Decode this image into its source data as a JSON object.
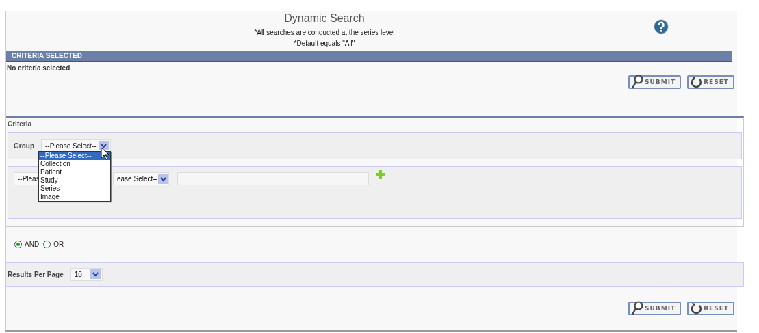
{
  "header": {
    "title": "Dynamic Search",
    "notes": [
      "*All searches are conducted at the series level",
      "*Default equals \"All\""
    ]
  },
  "criteria_selected": {
    "heading": "CRITERIA SELECTED",
    "message": "No criteria selected"
  },
  "actions_top": [
    {
      "kind": "submit",
      "label": "SUBMIT"
    },
    {
      "kind": "reset",
      "label": "RESET"
    }
  ],
  "criteria": {
    "heading": "Criteria",
    "group": {
      "label": "Group",
      "value": "--Please Select--",
      "expanded": true,
      "options": [
        {
          "label": "--Please Select--",
          "selected": true
        },
        {
          "label": "Collection",
          "selected": false
        },
        {
          "label": "Patient",
          "selected": false
        },
        {
          "label": "Study",
          "selected": false
        },
        {
          "label": "Series",
          "selected": false
        },
        {
          "label": "Image",
          "selected": false
        }
      ]
    },
    "row": {
      "field_select": "--Pleas",
      "operator_select": "ease Select--"
    }
  },
  "logic": [
    {
      "label": "AND",
      "selected": true
    },
    {
      "label": "OR",
      "selected": false
    }
  ],
  "results_per_page": {
    "label": "Results Per Page",
    "value": "10"
  },
  "actions_bottom": [
    {
      "kind": "submit",
      "label": "SUBMIT"
    },
    {
      "kind": "reset",
      "label": "RESET"
    }
  ]
}
